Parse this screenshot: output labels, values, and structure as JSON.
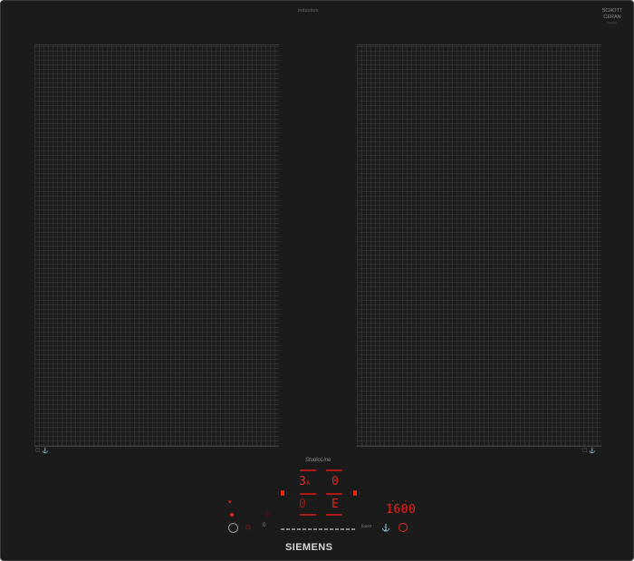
{
  "header": {
    "brand_small": "induction",
    "ceramic_brand": "SCHOTT",
    "ceramic_sub": "CERAN",
    "ceramic_fine": "induction"
  },
  "zones": [
    {
      "name": "left-zone",
      "mark": "☐ ⚓"
    },
    {
      "name": "right-zone",
      "mark": "☐ ⚓"
    }
  ],
  "panel": {
    "series": "StudioLine",
    "zone_front_left_level": "3",
    "zone_front_left_suffix": "A",
    "zone_front_left_rear": "0",
    "zone_front_right_level": "0",
    "zone_front_right_rear": "E",
    "timer_display": "1600",
    "slider_min": "0",
    "slider_max": "boost"
  },
  "logo": "SIEMENS",
  "colors": {
    "display_red": "#e3261f",
    "glass": "#1b1b1b"
  }
}
